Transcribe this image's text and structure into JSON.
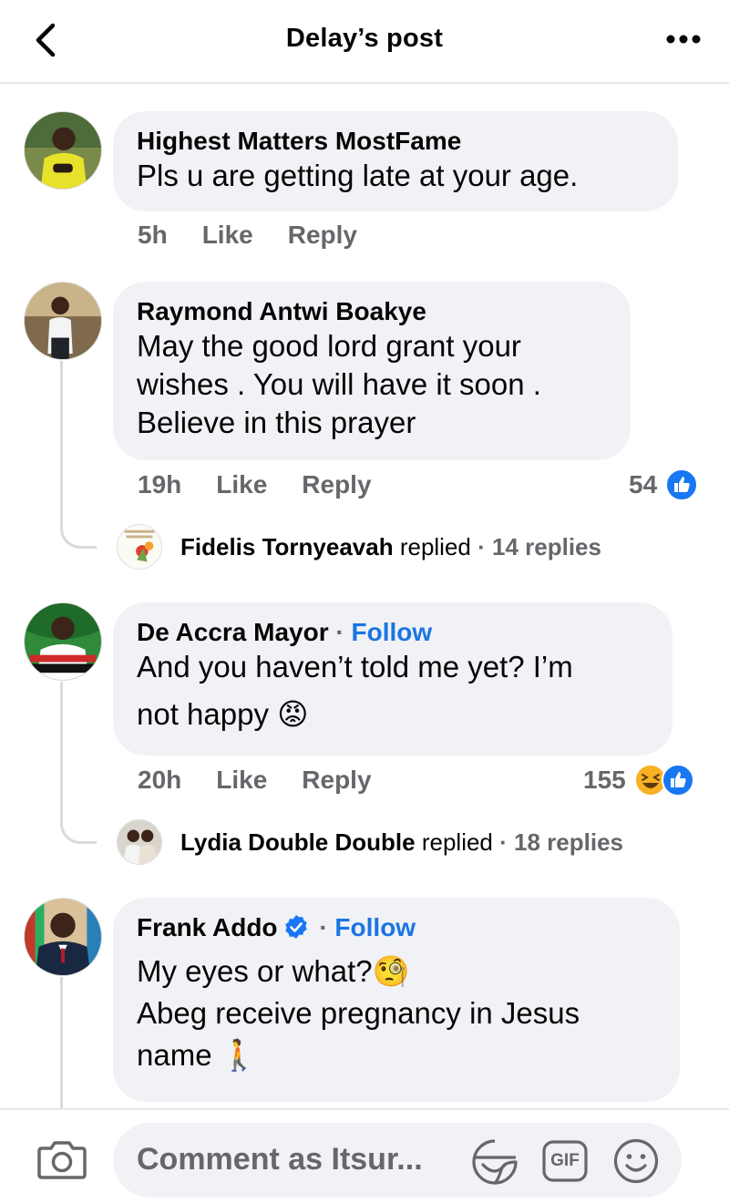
{
  "header": {
    "title": "Delay’s post"
  },
  "comments": [
    {
      "author": "Highest Matters MostFame",
      "text": "Pls u are getting late at your age.",
      "time": "5h",
      "like_label": "Like",
      "reply_label": "Reply"
    },
    {
      "author": "Raymond Antwi Boakye",
      "text_lines": [
        "May the good lord grant your",
        "wishes . You will have it soon .",
        "Believe in this prayer"
      ],
      "time": "19h",
      "like_label": "Like",
      "reply_label": "Reply",
      "reaction_count": "54",
      "reactions": [
        "like"
      ],
      "replies": {
        "name": "Fidelis Tornyeavah",
        "replied_label": "replied",
        "count_label": "· 14 replies"
      }
    },
    {
      "author": "De Accra Mayor",
      "follow_dot": "·",
      "follow_label": "Follow",
      "text_lines": [
        "And you haven’t told me yet? I’m",
        "not happy 😡"
      ],
      "time": "20h",
      "like_label": "Like",
      "reply_label": "Reply",
      "reaction_count": "155",
      "reactions": [
        "haha",
        "like"
      ],
      "replies": {
        "name": "Lydia Double Double",
        "replied_label": "replied",
        "count_label": "· 18 replies"
      }
    },
    {
      "author": "Frank Addo",
      "verified": true,
      "follow_dot": "·",
      "follow_label": "Follow",
      "text_lines": [
        "My eyes or what?🧐",
        "Abeg receive pregnancy in Jesus",
        "name 🚶"
      ]
    }
  ],
  "composer": {
    "placeholder": "Comment as Itsur...",
    "gif_label": "GIF"
  },
  "colors": {
    "link": "#1b74e4",
    "bubble": "#f0f2f5",
    "secondary_text": "#65676b",
    "like_blue": "#1877f2"
  },
  "icons": [
    "back-arrow-icon",
    "more-icon",
    "like-reaction-icon",
    "haha-reaction-icon",
    "verified-badge-icon",
    "camera-icon",
    "sticker-icon",
    "gif-icon",
    "emoji-icon"
  ]
}
